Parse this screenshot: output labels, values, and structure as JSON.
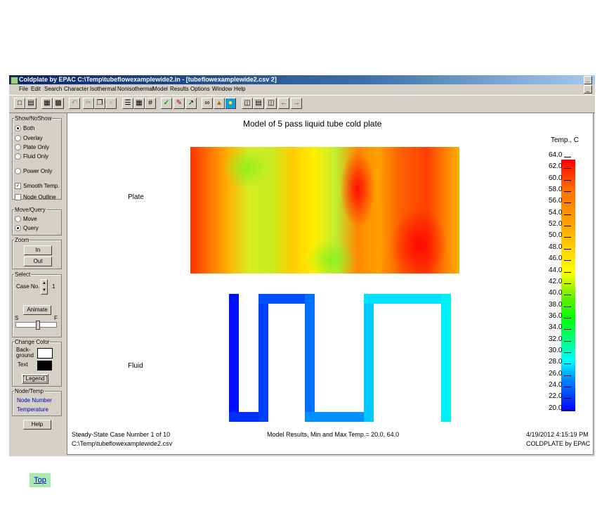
{
  "window": {
    "title": "Coldplate by EPAC   C:\\Temp\\tubeflowexamplewide2.in - [tubeflowexamplewide2.csv 2]",
    "min_label": "_",
    "close_label": "x"
  },
  "menu": [
    "File",
    "Edit",
    "Search",
    "Character",
    "Isothermal",
    "Nonisothermal",
    "Model",
    "Results",
    "Options",
    "Window",
    "Help"
  ],
  "toolbar_icons": [
    "new-file-icon",
    "open-folder-icon",
    "save-icon",
    "print-icon",
    "undo-icon",
    "cut-icon",
    "copy-icon",
    "paste-icon",
    "node-list-icon",
    "grid-icon",
    "hash-grid-icon",
    "checkmark-icon",
    "pencil-check-icon",
    "run-icon",
    "glasses-icon",
    "surface-plot-icon",
    "color-map-icon",
    "layers-icon",
    "split-horizontal-icon",
    "split-vertical-icon",
    "arrow-left-icon",
    "arrow-right-icon"
  ],
  "left_panel": {
    "show_group": "Show/NoShow",
    "show_options": [
      "Both",
      "Overlay",
      "Plate Only",
      "Fluid Only"
    ],
    "show_selected": "Both",
    "power_only": "Power Only",
    "smooth_temp": "Smooth Temp.",
    "smooth_checked": true,
    "node_outline": "Node Outline",
    "node_outline_checked": false,
    "move_group": "Move/Query",
    "move_options": [
      "Move",
      "Query"
    ],
    "move_selected": "Query",
    "zoom_group": "Zoom",
    "zoom_in": "In",
    "zoom_out": "Out",
    "select_group": "Select",
    "case_label": "Case No.",
    "case_value": "1",
    "animate": "Animate",
    "slider_start": "S",
    "slider_end": "F",
    "change_color_group": "Change Color",
    "background_label": "Back-\nground",
    "text_label": "Text",
    "background_color": "#ffffff",
    "text_color": "#000000",
    "legend_button": "Legend",
    "node_temp_group": "Node/Temp",
    "node_number": "Node Number",
    "temperature": "Temperature",
    "help": "Help"
  },
  "plot": {
    "title": "Model of 5 pass liquid tube cold plate",
    "plate_label": "Plate",
    "fluid_label": "Fluid",
    "legend_title": "Temp., C",
    "legend_ticks": [
      "64.0",
      "62.0",
      "60.0",
      "58.0",
      "56.0",
      "54.0",
      "52.0",
      "50.0",
      "48.0",
      "46.0",
      "44.0",
      "42.0",
      "40.0",
      "38.0",
      "36.0",
      "34.0",
      "32.0",
      "30.0",
      "28.0",
      "26.0",
      "24.0",
      "22.0",
      "20.0"
    ],
    "footer_left_1": "Steady-State Case Number 1 of 10",
    "footer_left_2": "C:\\Temp\\tubeflowexamplewide2.csv",
    "footer_center": "Model Results, Min and Max Temp.= 20.0, 64.0",
    "footer_right_1": "4/19/2012  4:15:19 PM",
    "footer_right_2": "COLDPLATE by EPAC",
    "colors": {
      "hot": "#ff0000",
      "warm": "#ffa000",
      "mid": "#ffff00",
      "cool_green": "#00ff00",
      "cyan": "#00ffff",
      "blue": "#0000ff"
    }
  },
  "page_link": "Top"
}
